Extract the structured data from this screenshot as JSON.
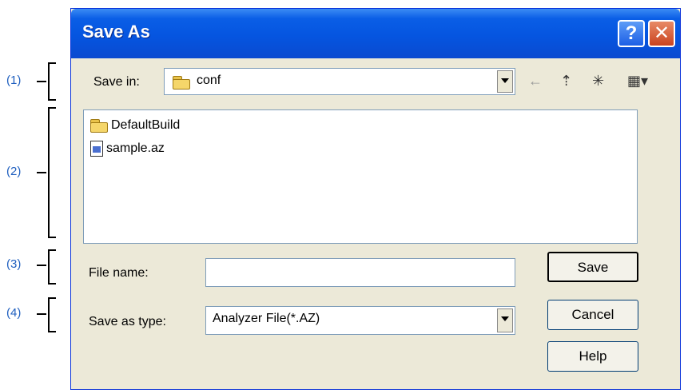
{
  "callouts": [
    "(1)",
    "(2)",
    "(3)",
    "(4)"
  ],
  "window": {
    "title": "Save As",
    "help_glyph": "?",
    "close_glyph": "✕"
  },
  "save_in": {
    "label": "Save in:",
    "value": "conf"
  },
  "toolbar_icons": [
    "back-arrow-icon",
    "up-one-level-icon",
    "new-folder-icon",
    "view-menu-icon"
  ],
  "files": [
    {
      "name": "DefaultBuild",
      "icon": "folder-icon"
    },
    {
      "name": "sample.az",
      "icon": "analyzer-file-icon"
    }
  ],
  "file_name": {
    "label": "File name:",
    "value": ""
  },
  "save_as_type": {
    "label": "Save as type:",
    "value": "Analyzer File(*.AZ)"
  },
  "buttons": {
    "save": "Save",
    "cancel": "Cancel",
    "help": "Help"
  },
  "colors": {
    "titlebar": "#0555e0",
    "callout_text": "#1f5fbf",
    "dialog_bg": "#ece9d8"
  }
}
